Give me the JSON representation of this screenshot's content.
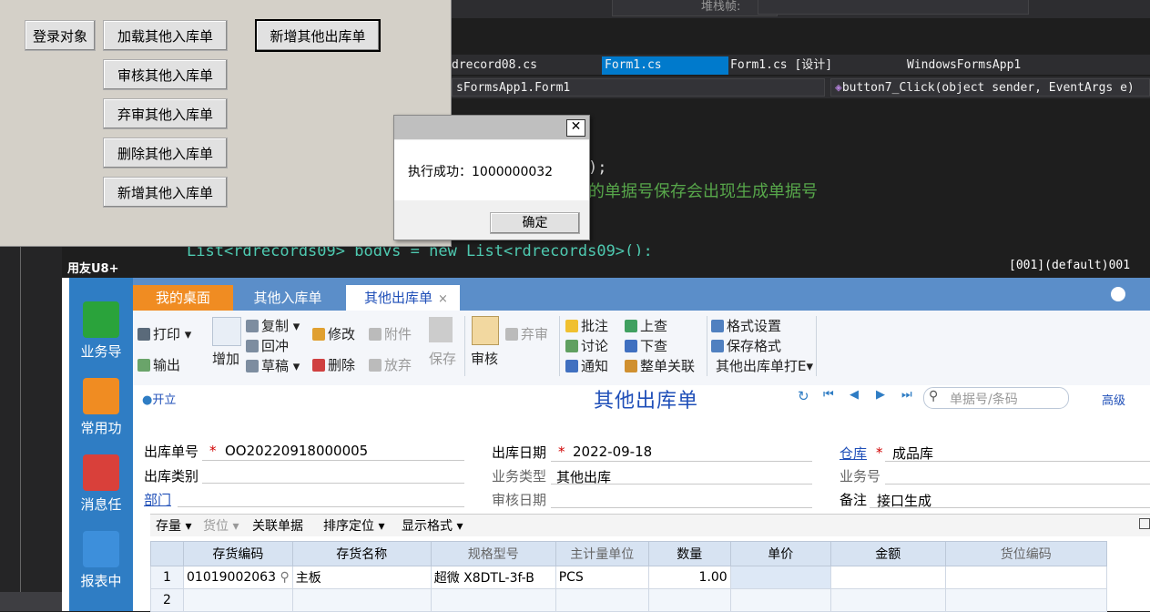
{
  "vs": {
    "top_combo_label": "堆栈帧:",
    "tabs": [
      "drecord08.cs",
      "Form1.cs",
      "Form1.cs [设计]",
      "WindowsFormsApp1"
    ],
    "nav_left": "sFormsApp1.Form1",
    "nav_right": "button7_Click(object sender, EventArgs e)",
    "code_line1": ");",
    "code_comment": "的单据号保存会出现生成单据号",
    "code_line3": "List<rdrecords09> bodys = new List<rdrecords09>();"
  },
  "testform": {
    "buttons": [
      "登录对象",
      "加载其他入库单",
      "新增其他出库单",
      "审核其他入库单",
      "弃审其他入库单",
      "删除其他入库单",
      "新增其他入库单"
    ]
  },
  "dialog": {
    "close": "✕",
    "message": "执行成功：1000000032",
    "ok": "确定"
  },
  "u8": {
    "brand": "用友U8+",
    "account": "[001](default)001",
    "left_nav": [
      "业务导",
      "常用功",
      "消息任",
      "报表中"
    ],
    "tabs": [
      "我的桌面",
      "其他入库单",
      "其他出库单"
    ],
    "tab_close": "×",
    "toolbar": {
      "print": "打印",
      "export": "输出",
      "add": "增加",
      "copy": "复制",
      "redflush": "回冲",
      "draft": "草稿",
      "modify": "修改",
      "delete": "删除",
      "attach": "附件",
      "discard": "放弃",
      "save": "保存",
      "audit": "审核",
      "unaudit": "弃审",
      "annotate": "批注",
      "discuss": "讨论",
      "notify": "通知",
      "prev_query": "上查",
      "next_query": "下查",
      "whole_link": "整单关联",
      "format_setting": "格式设置",
      "save_format": "保存格式",
      "print_template": "其他出库单打E"
    },
    "status": "开立",
    "form_title": "其他出库单",
    "search_placeholder": "单据号/条码",
    "advanced": "高级",
    "fields": {
      "out_no_label": "出库单号",
      "out_no": "OO20220918000005",
      "out_date_label": "出库日期",
      "out_date": "2022-09-18",
      "warehouse_label": "仓库",
      "warehouse": "成品库",
      "out_type_label": "出库类别",
      "out_type": "",
      "biz_type_label": "业务类型",
      "biz_type": "其他出库",
      "biz_no_label": "业务号",
      "biz_no": "",
      "dept_label": "部门",
      "dept": "",
      "audit_date_label": "审核日期",
      "audit_date": "",
      "remark_label": "备注",
      "remark": "接口生成"
    },
    "grid_toolbar": [
      "存量",
      "货位",
      "关联单据",
      "排序定位",
      "显示格式"
    ],
    "grid": {
      "headers": [
        "",
        "存货编码",
        "存货名称",
        "规格型号",
        "主计量单位",
        "数量",
        "单价",
        "金额",
        "货位编码"
      ],
      "rows": [
        [
          "1",
          "01019002063",
          "主板",
          "超微 X8DTL-3f-B",
          "PCS",
          "1.00",
          "",
          "",
          ""
        ],
        [
          "2",
          "",
          "",
          "",
          "",
          "",
          "",
          "",
          ""
        ]
      ]
    }
  },
  "colors": {
    "u8_blue": "#2f7dc4",
    "tab_active": "#f08c22",
    "title_blue": "#1f4fb8"
  }
}
